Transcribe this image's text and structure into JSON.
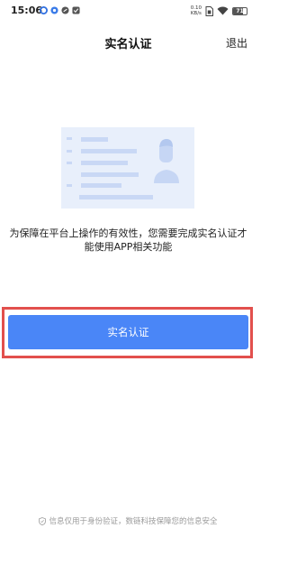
{
  "status_bar": {
    "time": "15:06",
    "net_speed_value": "0.10",
    "net_speed_unit": "KB/s",
    "battery_level": "71",
    "notification_icons": [
      "blue-circle-icon",
      "blue-dot-icon",
      "sync-icon",
      "gallery-icon"
    ],
    "right_icons": [
      "sim-icon",
      "wifi-icon",
      "battery-icon"
    ]
  },
  "header": {
    "title": "实名认证",
    "exit_label": "退出"
  },
  "main": {
    "illustration": "id-card-illustration",
    "notice": "为保障在平台上操作的有效性，您需要完成实名认证才能使用APP相关功能",
    "verify_button_label": "实名认证"
  },
  "footer": {
    "icon": "shield-icon",
    "text": "信息仅用于身份验证，数链科技保障您的信息安全"
  },
  "colors": {
    "accent": "#4a86f7",
    "highlight_border": "#e2504d",
    "card_background": "#e8effb",
    "card_lines": "#c9d8f5",
    "avatar": "#c6d6f4",
    "footer_text": "#9a9a9a"
  }
}
